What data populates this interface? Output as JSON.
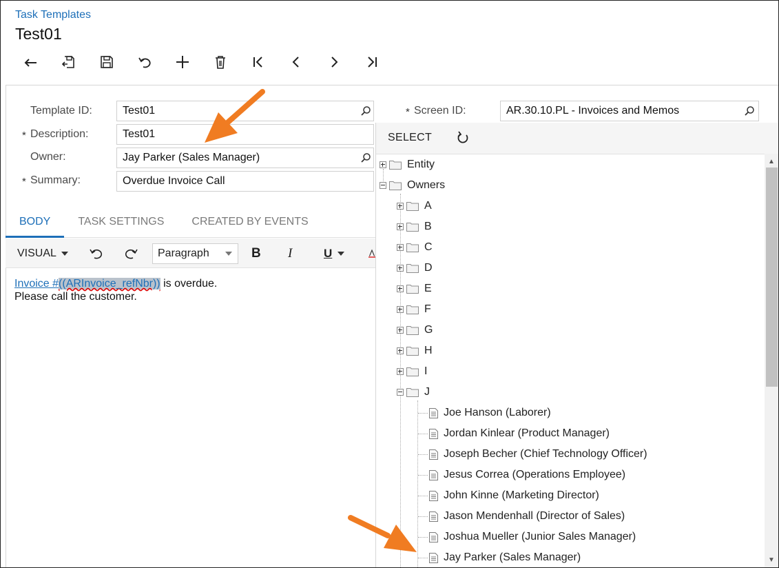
{
  "breadcrumb": "Task Templates",
  "title": "Test01",
  "form": {
    "template_id_label": "Template ID:",
    "template_id_value": "Test01",
    "description_label": "Description:",
    "description_value": "Test01",
    "owner_label": "Owner:",
    "owner_value": "Jay Parker (Sales Manager)",
    "summary_label": "Summary:",
    "summary_value": "Overdue Invoice Call",
    "screen_id_label": "Screen ID:",
    "screen_id_value": "AR.30.10.PL - Invoices and Memos",
    "required_mark": "*"
  },
  "tabs": [
    "BODY",
    "TASK SETTINGS",
    "CREATED BY EVENTS"
  ],
  "editor": {
    "mode": "VISUAL",
    "paragraph": "Paragraph",
    "bold": "B",
    "italic": "I",
    "underline": "U",
    "line1_link": "Invoice #",
    "line1_placeholder": "((ARInvoice_refNbr))",
    "line1_rest": " is overdue.",
    "line2": "Please call the customer."
  },
  "panel": {
    "select_label": "SELECT",
    "tree_entity": "Entity",
    "tree_owners": "Owners",
    "letters": [
      "A",
      "B",
      "C",
      "D",
      "E",
      "F",
      "G",
      "H",
      "I",
      "J"
    ],
    "j_owners": [
      "Joe Hanson (Laborer)",
      "Jordan Kinlear (Product Manager)",
      "Joseph Becher (Chief Technology Officer)",
      "Jesus Correa (Operations Employee)",
      "John Kinne (Marketing Director)",
      "Jason Mendenhall (Director of Sales)",
      "Joshua Mueller (Junior Sales Manager)",
      "Jay Parker (Sales Manager)"
    ]
  },
  "colors": {
    "accent": "#1d6fb8",
    "callout_arrow": "#f07c22"
  },
  "icons": {
    "toolbar": [
      "back-icon",
      "save-close-icon",
      "save-icon",
      "undo-icon",
      "add-icon",
      "delete-icon",
      "first-icon",
      "previous-icon",
      "next-icon",
      "last-icon"
    ]
  }
}
